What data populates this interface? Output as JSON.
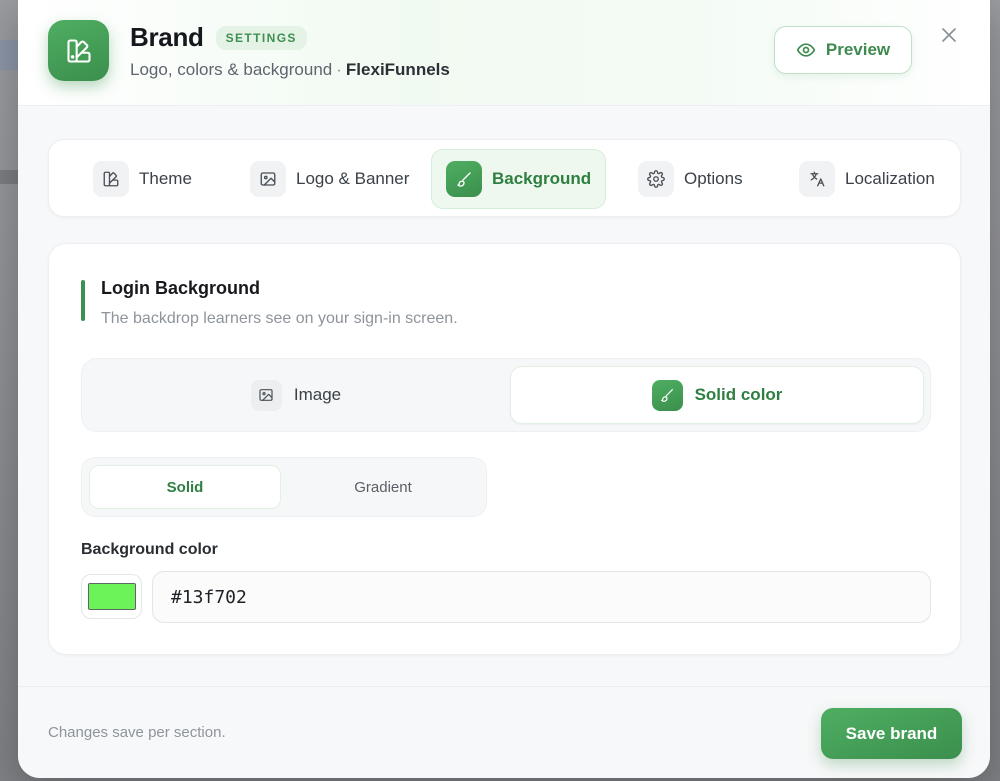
{
  "header": {
    "title": "Brand",
    "badge": "SETTINGS",
    "subtitle_prefix": "Logo, colors & background",
    "subtitle_separator": "·",
    "subtitle_workspace": "FlexiFunnels",
    "preview_label": "Preview"
  },
  "tabs": [
    {
      "label": "Theme",
      "icon": "palette-icon",
      "active": false
    },
    {
      "label": "Logo & Banner",
      "icon": "image-icon",
      "active": false
    },
    {
      "label": "Background",
      "icon": "brush-icon",
      "active": true
    },
    {
      "label": "Options",
      "icon": "gear-icon",
      "active": false
    },
    {
      "label": "Localization",
      "icon": "translate-icon",
      "active": false
    }
  ],
  "section": {
    "title": "Login Background",
    "description": "The backdrop learners see on your sign-in screen."
  },
  "background_type": {
    "options": [
      {
        "label": "Image",
        "icon": "image-icon",
        "active": false
      },
      {
        "label": "Solid color",
        "icon": "brush-icon",
        "active": true
      }
    ]
  },
  "fill_mode": {
    "options": [
      {
        "label": "Solid",
        "active": true
      },
      {
        "label": "Gradient",
        "active": false
      }
    ]
  },
  "color_field": {
    "label": "Background color",
    "value": "#13f702",
    "swatch_display_color": "#6cf35a"
  },
  "footer": {
    "note": "Changes save per section.",
    "save_label": "Save brand"
  },
  "colors": {
    "accent": "#3d9150",
    "accent_light": "#eef8ef"
  }
}
